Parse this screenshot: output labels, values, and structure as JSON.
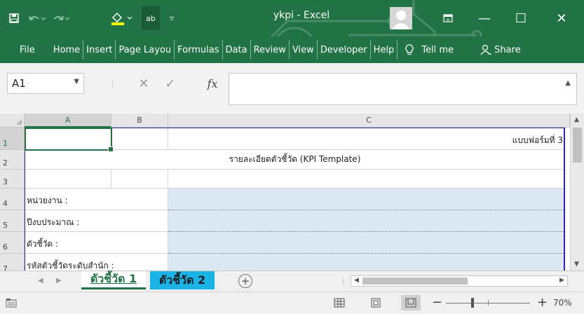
{
  "window": {
    "title": "ykpi  -  Excel",
    "minimize": "—",
    "maximize": "☐",
    "close": "✕"
  },
  "colors": {
    "excel_green": "#217346",
    "input_cell_blue": "#dce8f3",
    "sheet_tab_2": "#1bb4e8",
    "outline_blue": "#2b2b9b"
  },
  "icons": {
    "save": "save-icon",
    "undo": "undo-icon",
    "redo": "redo-icon",
    "fill": "fill-color-icon",
    "spelling": "spelling-icon",
    "customize": "customize-qat-icon",
    "user": "user-avatar-icon",
    "ribbon_display": "ribbon-display-icon"
  },
  "quick_access": {
    "spelling_label": "ab",
    "customize_label": "▿"
  },
  "ribbon": {
    "tabs": [
      "File",
      "Home",
      "Insert",
      "Page Layou",
      "Formulas",
      "Data",
      "Review",
      "View",
      "Developer",
      "Help"
    ],
    "tell_me": "Tell me",
    "share": "Share"
  },
  "formula_bar": {
    "name_box": "A1",
    "fx": "fx",
    "value": ""
  },
  "grid": {
    "columns": [
      "A",
      "B",
      "C"
    ],
    "rows": [
      "1",
      "2",
      "3",
      "4",
      "5",
      "6",
      "7"
    ],
    "cells": {
      "c1": "แบบฟอร์มที่ 3",
      "title": "รายละเอียดตัวชี้วัด (KPI Template)",
      "a4": "หน่วยงาน :",
      "a5": "ปีงบประมาณ :",
      "a6": "ตัวชี้วัด :",
      "a7": "รหัสตัวชี้วัดระดับสำนัก :"
    }
  },
  "sheets": {
    "tabs": [
      "ตัวชี้วัด 1",
      "ตัวชี้วัด 2"
    ],
    "active": "ตัวชี้วัด 1",
    "add": "+"
  },
  "status": {
    "zoom": "70%"
  }
}
